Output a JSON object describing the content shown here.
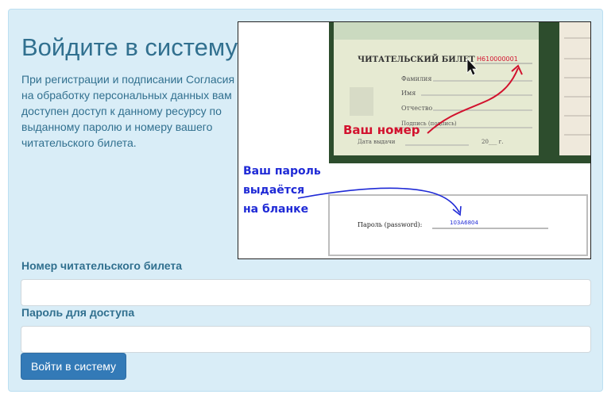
{
  "login": {
    "title": "Войдите в систему",
    "description": "При регистрации и подписании Согласия на обработку персональных данных вам доступен доступ к данному ресурсу по выданному паролю и номеру вашего читательского билета.",
    "card_number_label": "Номер читательского билета",
    "card_number_value": "",
    "password_label": "Пароль для доступа",
    "password_value": "",
    "submit_label": "Войти в систему"
  },
  "illustration": {
    "card_heading": "ЧИТАТЕЛЬСКИЙ БИЛЕТ",
    "card_number": "Н610000001",
    "field_surname": "Фамилия",
    "field_name": "Имя",
    "field_patronymic": "Отчество",
    "field_signature": "Подпись (подпись)",
    "field_issue_date": "Дата выдачи",
    "year_stub": "20___ г.",
    "your_number_caption": "Ваш номер",
    "password_caption_line1": "Ваш пароль",
    "password_caption_line2": "выдаётся",
    "password_caption_line3": "на бланке",
    "password_form_label": "Пароль (password):",
    "password_form_value": "103A6804"
  },
  "colors": {
    "panel_bg": "#d9edf7",
    "text": "#31708f",
    "button_bg": "#337ab7",
    "card_green": "#2d4d2d",
    "red_caption": "#d2122e",
    "blue_caption": "#1f2ad6"
  }
}
